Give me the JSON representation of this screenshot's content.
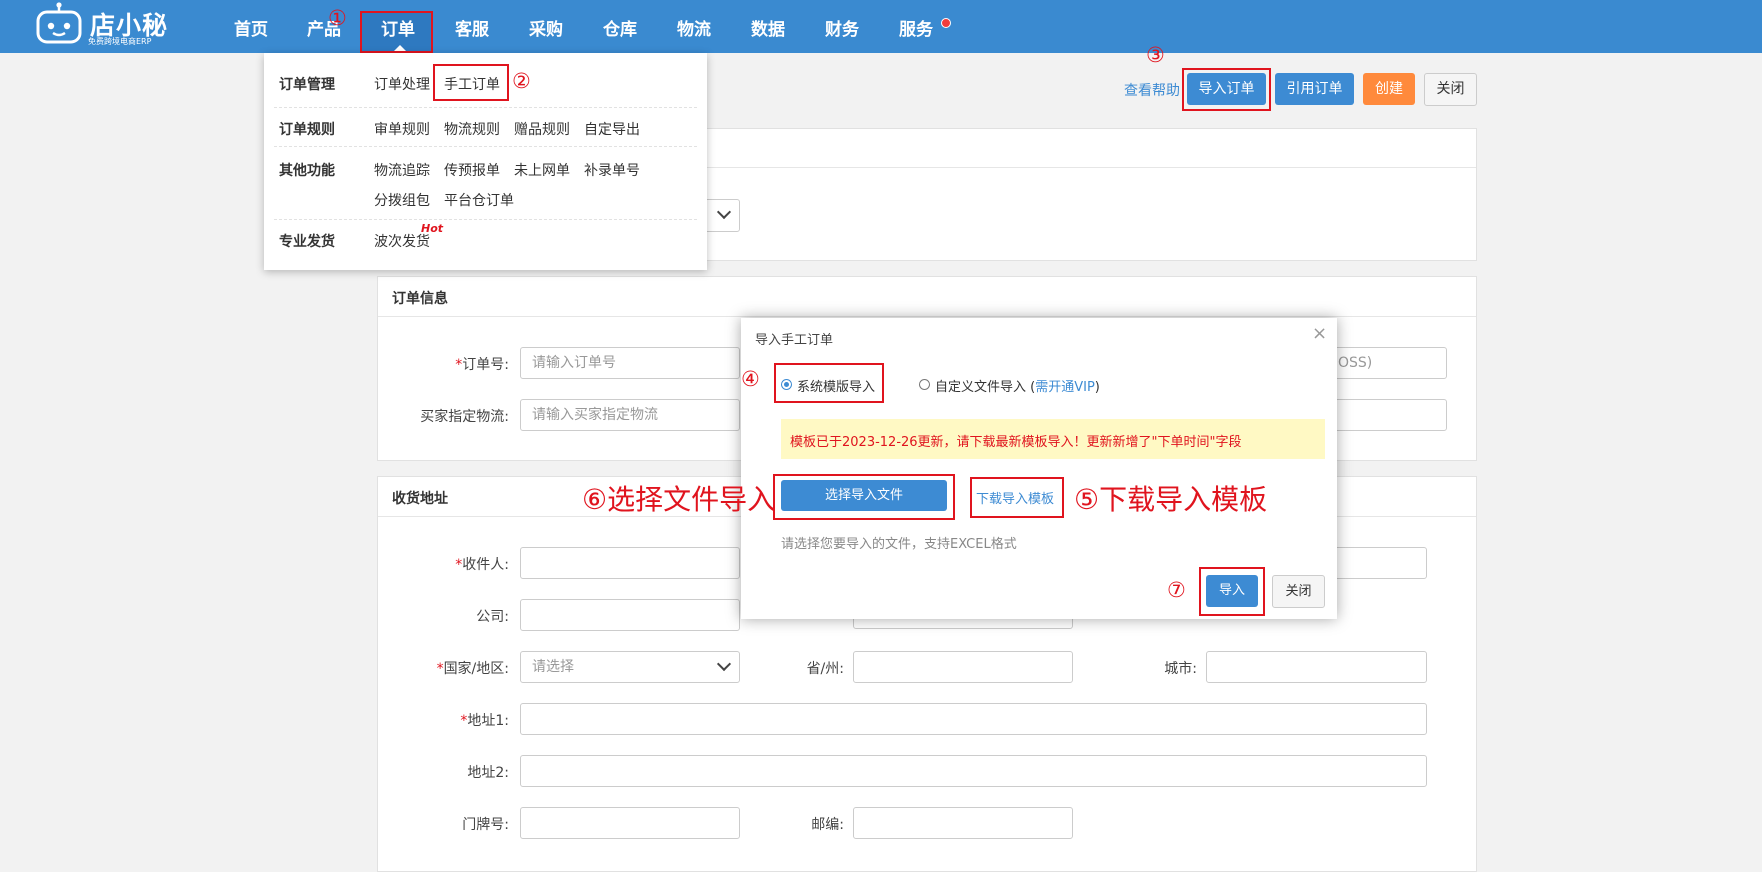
{
  "brand": {
    "name": "店小秘",
    "slogan": "免费跨境电商ERP"
  },
  "nav": {
    "items": [
      "首页",
      "产品",
      "订单",
      "客服",
      "采购",
      "仓库",
      "物流",
      "数据",
      "财务",
      "服务"
    ],
    "active": "订单",
    "dot_item": "服务"
  },
  "annotations": {
    "n1": "①",
    "n2": "②",
    "n3": "③",
    "n4": "④",
    "n5": "⑤",
    "n6": "⑥",
    "n7": "⑦",
    "download_hint": "⑤下载导入模板",
    "select_hint": "⑥选择文件导入"
  },
  "order_menu": {
    "groups": [
      {
        "title": "订单管理",
        "items": [
          "订单处理",
          "手工订单"
        ]
      },
      {
        "title": "订单规则",
        "items": [
          "审单规则",
          "物流规则",
          "赠品规则",
          "自定导出"
        ]
      },
      {
        "title": "其他功能",
        "items": [
          "物流追踪",
          "传预报单",
          "未上网单",
          "补录单号",
          "分拨组包",
          "平台仓订单"
        ]
      },
      {
        "title": "专业发货",
        "items": [
          "波次发货"
        ],
        "badge": "Hot"
      }
    ]
  },
  "toolbar": {
    "help": "查看帮助",
    "import_btn": "导入订单",
    "quote_btn": "引用订单",
    "create_btn": "创建",
    "close_btn": "关闭"
  },
  "order_info": {
    "title": "订单信息",
    "order_no_label": "订单号:",
    "order_no_placeholder": "请输入订单号",
    "buyer_logistics_label": "买家指定物流:",
    "buyer_logistics_placeholder": "请输入买家指定物流",
    "right_field_fragment": "OSS)"
  },
  "address": {
    "title": "收货地址",
    "recipient_label": "收件人:",
    "company_label": "公司:",
    "country_label": "国家/地区:",
    "country_placeholder": "请选择",
    "province_label": "省/州:",
    "city_label": "城市:",
    "address1_label": "地址1:",
    "address2_label": "地址2:",
    "house_no_label": "门牌号:",
    "postcode_label": "邮编:"
  },
  "modal": {
    "title": "导入手工订单",
    "close_symbol": "×",
    "radio_system": "系统模版导入",
    "radio_custom": "自定义文件导入 (",
    "vip_link": "需开通VIP",
    "radio_custom_end": ")",
    "notice": "模板已于2023-12-26更新，请下载最新模板导入！更新新增了\"下单时间\"字段",
    "select_file_btn": "选择导入文件",
    "download_link": "下载导入模板",
    "hint": "请选择您要导入的文件，支持EXCEL格式",
    "import_btn": "导入",
    "close_btn": "关闭",
    "system_selected": true
  },
  "colors": {
    "topbar": "#3a8ad0",
    "primary": "#3d8bd3",
    "orange": "#ff8a3c",
    "annotation_red": "#e0141e",
    "notice_bg": "#fff9c4"
  }
}
